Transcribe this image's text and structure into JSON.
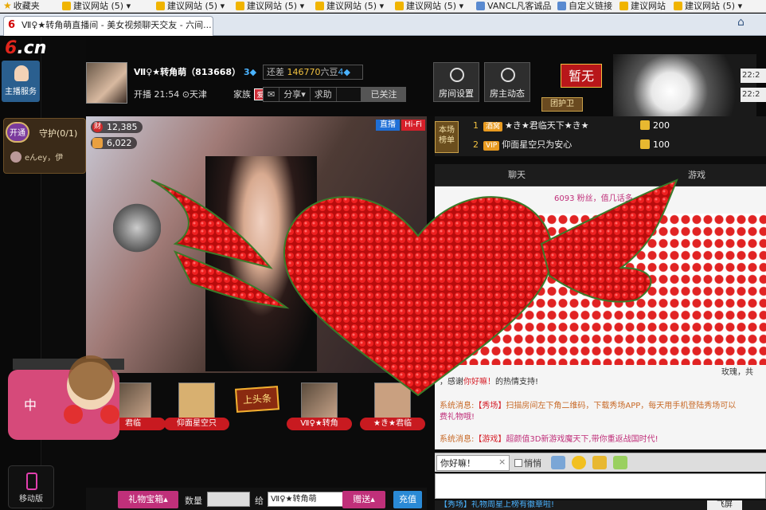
{
  "favorites": {
    "favorites_label": "收藏夹",
    "items": [
      "建议网站 (5)",
      "建议网站 (5)",
      "建议网站 (5)",
      "建议网站 (5)",
      "建议网站 (5)",
      "VANCL凡客诚品",
      "自定义链接",
      "建议网站",
      "建议网站 (5)"
    ]
  },
  "tab": {
    "title": "Ⅶ♀★转角萌直播间 - 美女视频聊天交友 - 六间..."
  },
  "site": {
    "logo_text": "6.cn",
    "anchor_service": "主播服务"
  },
  "guard": {
    "open_label": "开通",
    "label": "守护(0/1)",
    "user": "eんey，伊"
  },
  "host": {
    "name": "Ⅶ♀★转角萌（813668）",
    "level": "3",
    "diff_label": "还差",
    "diff_value": "146770",
    "diff_unit": "六豆",
    "diff_level": "4",
    "live_time": "开播 21:54",
    "location": "天津",
    "family_label": "家族",
    "family_badge": "爱",
    "tools": [
      "✉",
      "分享▾",
      "求助"
    ],
    "follow": "已关注"
  },
  "top_buttons": {
    "room_settings": "房间设置",
    "host_dynamics": "房主动态"
  },
  "pause_label": "暂无",
  "guard_tag": "团护卫",
  "time_fields": [
    "22:2",
    "22:2"
  ],
  "video": {
    "fans": "12,385",
    "gifts": "6,022",
    "live_badge": "直播",
    "hifi_badge": "Hi-Fi"
  },
  "leaderboard": {
    "tag": "本场榜单",
    "ranks": [
      {
        "no": "1",
        "vip": "酒窝",
        "name": "★き★君临天下★き★",
        "coins": "200"
      },
      {
        "no": "2",
        "vip": "VIP",
        "name": "仰面星空只为安心",
        "coins": "100"
      }
    ]
  },
  "chat_tabs": [
    "聊天",
    "游戏"
  ],
  "chat": {
    "top_line": "6093 粉丝，值几话多",
    "thanks_prefix": "，感谢",
    "thanks_name": "你好嘛！",
    "thanks_suffix": "的热情支持!",
    "rose_tail": "玫瑰，共",
    "sys1_prefix": "系统消息:",
    "sys1_hl": "【秀场】",
    "sys1_text": "扫描房间左下角二维码，下载秀场APP，每天用手机登陆秀场可以",
    "sys1_tail": "费礼物哦!",
    "sys2_prefix": "系统消息:",
    "sys2_hl": "【游戏】",
    "sys2_text": "超颜值3D新游戏魔天下,带你重返战国时代!"
  },
  "chat_input": {
    "value": "你好嘛！",
    "whisper": "悄悄"
  },
  "bottom_notice": "【秀场】礼物周星上榜有徽章啦!",
  "fly_label": "飞屏",
  "gift_row": {
    "seats": [
      "君临",
      "仰面星空只",
      "Ⅶ♀★转角",
      "★き★君临"
    ],
    "headline": "上头条"
  },
  "gift_bar": {
    "gift_box": "礼物宝箱▴",
    "qty_label": "数量",
    "to_label": "给",
    "to_value": "Ⅶ♀★转角萌",
    "send": "赠送▴",
    "recharge": "充值"
  },
  "mobile": "移动版",
  "colors": {
    "accent_red": "#d6202a",
    "accent_pink": "#c0307a",
    "accent_blue": "#2a8ad6",
    "gold": "#f0c040"
  }
}
